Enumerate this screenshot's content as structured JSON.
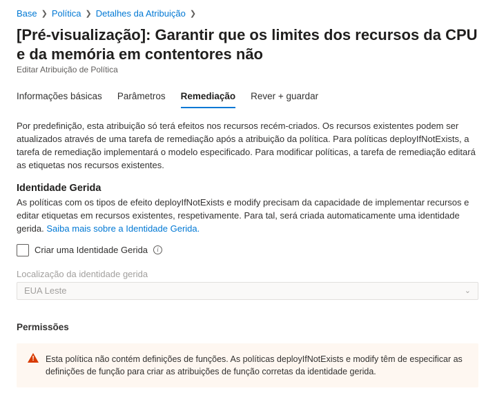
{
  "breadcrumb": {
    "items": [
      "Base",
      "Política",
      "Detalhes da Atribuição"
    ]
  },
  "header": {
    "title": "[Pré-visualização]: Garantir que os limites dos recursos da CPU e da memória em contentores não",
    "subtitle": "Editar Atribuição de Política"
  },
  "tabs": {
    "items": [
      "Informações básicas",
      "Parâmetros",
      "Remediação",
      "Rever + guardar"
    ],
    "activeIndex": 2
  },
  "remediation": {
    "description": "Por predefinição, esta atribuição só terá efeitos nos recursos recém-criados. Os recursos existentes podem ser atualizados através de uma tarefa de remediação após a atribuição da política. Para políticas deployIfNotExists, a tarefa de remediação implementará o modelo especificado. Para modificar políticas, a tarefa de remediação editará as etiquetas nos recursos existentes.",
    "identity_section_title": "Identidade Gerida",
    "identity_text": "As políticas com os tipos de efeito deployIfNotExists e modify precisam da capacidade de implementar recursos e editar etiquetas em recursos existentes, respetivamente. Para tal, será criada automaticamente uma identidade gerida. ",
    "identity_link": "Saiba mais sobre a Identidade Gerida.",
    "checkbox_label": "Criar uma Identidade Gerida",
    "location_label": "Localização da identidade gerida",
    "location_value": "EUA Leste"
  },
  "permissions": {
    "title": "Permissões",
    "warning": "Esta política não contém definições de funções. As políticas deployIfNotExists e modify têm de especificar as definições de função para criar as atribuições de função corretas da identidade gerida."
  }
}
